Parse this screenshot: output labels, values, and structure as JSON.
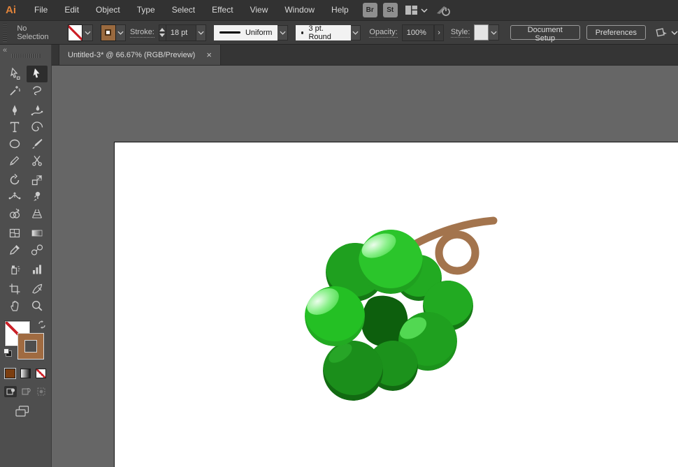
{
  "app": {
    "logo": "Ai",
    "name": "Adobe Illustrator"
  },
  "menubar": {
    "items": [
      "File",
      "Edit",
      "Object",
      "Type",
      "Select",
      "Effect",
      "View",
      "Window",
      "Help"
    ],
    "bridge_button": "Br",
    "stock_button": "St",
    "icons": [
      "workspace-switcher-icon",
      "chevron-down-icon",
      "gpu-performance-icon"
    ]
  },
  "controlbar": {
    "selection_status": "No Selection",
    "fill_swatch": "none",
    "stroke_swatch_color": "#9A6A3F",
    "stroke_label": "Stroke:",
    "stroke_weight": "18 pt",
    "variable_width_profile": "Uniform",
    "brush_definition": "3 pt. Round",
    "opacity_label": "Opacity:",
    "opacity_value": "100%",
    "opacity_more": "›",
    "style_label": "Style:",
    "document_setup_button": "Document Setup",
    "preferences_button": "Preferences"
  },
  "document_tab": {
    "title": "Untitled-3* @ 66.67% (RGB/Preview)",
    "close": "×"
  },
  "toolbar": {
    "collapse": "«",
    "active_tool": "selection-tool",
    "tools": [
      "direct-selection-tool",
      "selection-tool",
      "magic-wand-tool",
      "lasso-tool",
      "pen-tool",
      "curvature-tool",
      "type-tool",
      "spiral-tool",
      "ellipse-tool",
      "paintbrush-tool",
      "shaper-tool",
      "scissors-tool",
      "rotate-tool",
      "scale-tool",
      "width-tool",
      "puppet-warp-tool",
      "shape-builder-tool",
      "perspective-grid-tool",
      "mesh-tool",
      "gradient-tool",
      "eyedropper-tool",
      "blend-tool",
      "symbol-sprayer-tool",
      "column-graph-tool",
      "artboard-tool",
      "slice-tool",
      "hand-tool",
      "zoom-tool"
    ],
    "fill": "none",
    "stroke_color": "#A06B41",
    "drawing_modes": [
      "draw-normal",
      "draw-behind",
      "draw-inside"
    ],
    "active_drawing_mode": "draw-normal"
  },
  "canvas": {
    "artboard_color": "#FFFFFF",
    "pasteboard_color": "#666666",
    "artwork_description": "cluster of green grapes with a curled brown stem"
  },
  "artwork": {
    "palette": {
      "stem": "#A3744D",
      "bright": "#24C024",
      "bright2": "#2BC52B",
      "med": "#22AA22",
      "med2": "#1FA01F",
      "dark": "#1B8E1B",
      "dark2": "#1C921C",
      "shade": "#157815",
      "shade2": "#126A12",
      "deep": "#0D5F0D",
      "light_patch": "#52D852",
      "rim": "#27A527",
      "hl_core": "#EDFDED",
      "hl_mid": "#8CF08C",
      "hl_edge": "#55DE55"
    }
  }
}
